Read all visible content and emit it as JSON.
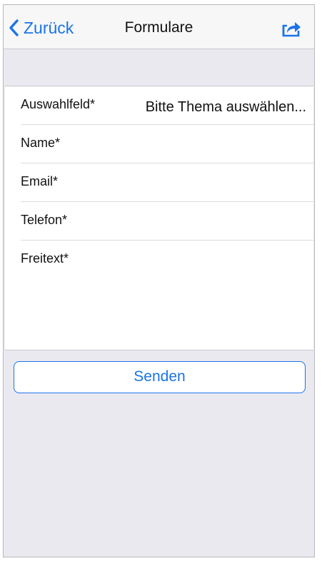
{
  "navbar": {
    "back_label": "Zurück",
    "title": "Formulare",
    "share_icon": "share-icon"
  },
  "form": {
    "fields": [
      {
        "label": "Auswahlfeld*",
        "value": "Bitte Thema auswählen..."
      },
      {
        "label": "Name*",
        "value": ""
      },
      {
        "label": "Email*",
        "value": ""
      },
      {
        "label": "Telefon*",
        "value": ""
      },
      {
        "label": "Freitext*",
        "value": ""
      }
    ]
  },
  "actions": {
    "send_label": "Senden"
  },
  "colors": {
    "accent": "#1a73e8",
    "background": "#ebe9f0",
    "card": "#ffffff"
  }
}
